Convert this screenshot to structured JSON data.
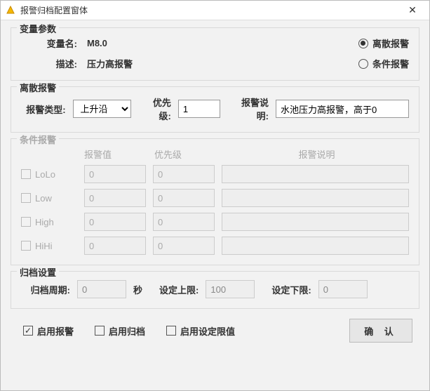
{
  "window": {
    "title": "报警归档配置窗体"
  },
  "var_section": {
    "legend": "变量参数",
    "name_label": "变量名:",
    "name_value": "M8.0",
    "desc_label": "描述:",
    "desc_value": "压力高报警",
    "radio_discrete": "离散报警",
    "radio_condition": "条件报警"
  },
  "discrete_section": {
    "legend": "离散报警",
    "type_label": "报警类型:",
    "type_value": "上升沿",
    "priority_label": "优先级:",
    "priority_value": "1",
    "desc_label": "报警说明:",
    "desc_value": "水池压力高报警，高于0"
  },
  "cond_section": {
    "legend": "条件报警",
    "head_value": "报警值",
    "head_priority": "优先级",
    "head_desc": "报警说明",
    "rows": [
      {
        "name": "LoLo",
        "value": "0",
        "priority": "0",
        "desc": ""
      },
      {
        "name": "Low",
        "value": "0",
        "priority": "0",
        "desc": ""
      },
      {
        "name": "High",
        "value": "0",
        "priority": "0",
        "desc": ""
      },
      {
        "name": "HiHi",
        "value": "0",
        "priority": "0",
        "desc": ""
      }
    ]
  },
  "archive_section": {
    "legend": "归档设置",
    "period_label": "归档周期:",
    "period_value": "0",
    "period_unit": "秒",
    "upper_label": "设定上限:",
    "upper_value": "100",
    "lower_label": "设定下限:",
    "lower_value": "0"
  },
  "footer": {
    "enable_alarm": "启用报警",
    "enable_archive": "启用归档",
    "enable_limits": "启用设定限值",
    "confirm": "确 认"
  }
}
